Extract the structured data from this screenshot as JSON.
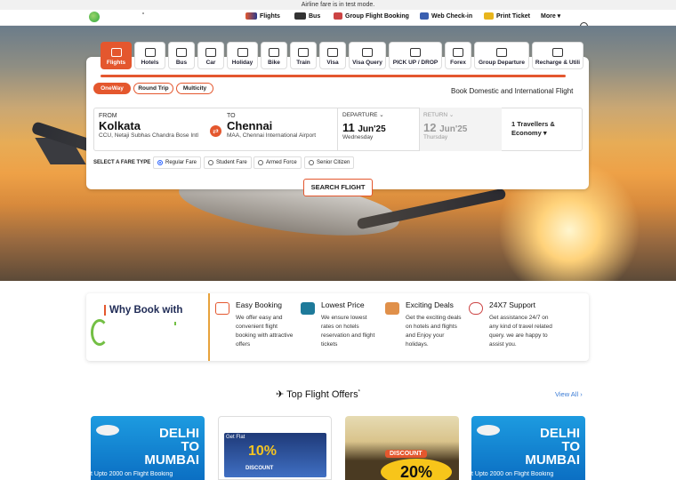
{
  "banner": "Airline fare is in test mode.",
  "nav": {
    "items": [
      "Flights",
      "Bus",
      "Group Flight Booking",
      "Web Check-in",
      "Print Ticket"
    ],
    "more": "More ▾"
  },
  "tabs": [
    "Flights",
    "Hotels",
    "Bus",
    "Car",
    "Holiday",
    "Bike",
    "Train",
    "Visa",
    "Visa Query",
    "PICK UP / DROP",
    "Forex",
    "Group Departure",
    "Recharge & Utili"
  ],
  "trip_types": [
    "OneWay",
    "Round Trip",
    "Multicity"
  ],
  "tagline": "Book Domestic and International Flight",
  "from": {
    "label": "FROM",
    "city": "Kolkata",
    "airport": "CCU, Netaji Subhas Chandra Bose Intl"
  },
  "to": {
    "label": "TO",
    "city": "Chennai",
    "airport": "MAA, Chennai International Airport"
  },
  "departure": {
    "label": "DEPARTURE ⌄",
    "day": "11",
    "month": "Jun'25",
    "weekday": "Wednesday"
  },
  "return": {
    "label": "RETURN ⌄",
    "day": "12",
    "month": "Jun'25",
    "weekday": "Thursday"
  },
  "travellers": {
    "line1": "1 Travellers &",
    "line2": "Economy ▾"
  },
  "fare": {
    "label": "SELECT A FARE TYPE",
    "options": [
      "Regular Fare",
      "Student Fare",
      "Armed Force",
      "Senior Citizen"
    ]
  },
  "search_button": "SEARCH FLIGHT",
  "why": {
    "title": "Why Book with",
    "features": [
      {
        "title": "Easy Booking",
        "desc": "We offer easy and convenient flight booking with attractive offers"
      },
      {
        "title": "Lowest Price",
        "desc": "We ensure lowest rates on hotels reservation and flight tickets"
      },
      {
        "title": "Exciting Deals",
        "desc": "Get the exciting deals on hotels and flights and Enjoy your holidays."
      },
      {
        "title": "24X7 Support",
        "desc": "Get assistance 24/7 on any kind of travel related query. we are happy to assist you."
      }
    ]
  },
  "offers": {
    "title": "✈ Top Flight Offers",
    "star": "*",
    "view_all": "View All ›",
    "cards": [
      {
        "line1": "DELHI",
        "line2": "TO",
        "line3": "MUMBAI",
        "foot": "t Upto 2000 on Flight Booking"
      },
      {
        "big": "10%",
        "disc": "DISCOUNT",
        "head": "Get Flat"
      },
      {
        "pill": "DISCOUNT",
        "pct": "20%"
      },
      {
        "line1": "DELHI",
        "line2": "TO",
        "line3": "MUMBAI",
        "foot": "t Upto 2000 on Flight Booking"
      }
    ]
  }
}
